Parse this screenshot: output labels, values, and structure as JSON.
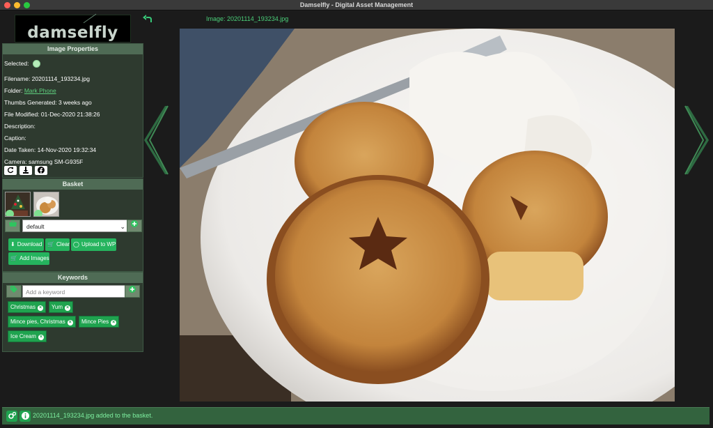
{
  "window": {
    "title": "Damselfly - Digital Asset Management"
  },
  "logo": {
    "text": "damselfly"
  },
  "header": {
    "image_title": "Image: 20201114_193234.jpg"
  },
  "properties": {
    "title": "Image Properties",
    "selected_label": "Selected:",
    "filename": "Filename: 20201114_193234.jpg",
    "folder_label": "Folder:",
    "folder_link": "Mark Phone",
    "thumbs": "Thumbs Generated: 3 weeks ago",
    "modified": "File Modified: 01-Dec-2020 21:38:26",
    "description": "Description:",
    "caption": "Caption:",
    "date_taken": "Date Taken: 14-Nov-2020 19:32:34",
    "camera": "Camera: samsung SM-G935F"
  },
  "basket": {
    "title": "Basket",
    "selected_basket": "default",
    "buttons": {
      "download": "Download",
      "clear": "Clear",
      "upload": "Upload to WP",
      "add_images": "Add Images"
    }
  },
  "keywords": {
    "title": "Keywords",
    "placeholder": "Add a keyword",
    "tags": [
      "Christmas",
      "Yum",
      "Mince pies, Christmas",
      "Mince Pies",
      "Ice Cream"
    ]
  },
  "status": {
    "message": "20201114_193234.jpg added to the basket."
  },
  "colors": {
    "accent": "#25b45e",
    "panel_head": "#4f6b55",
    "status_text": "#7ef0a0"
  }
}
